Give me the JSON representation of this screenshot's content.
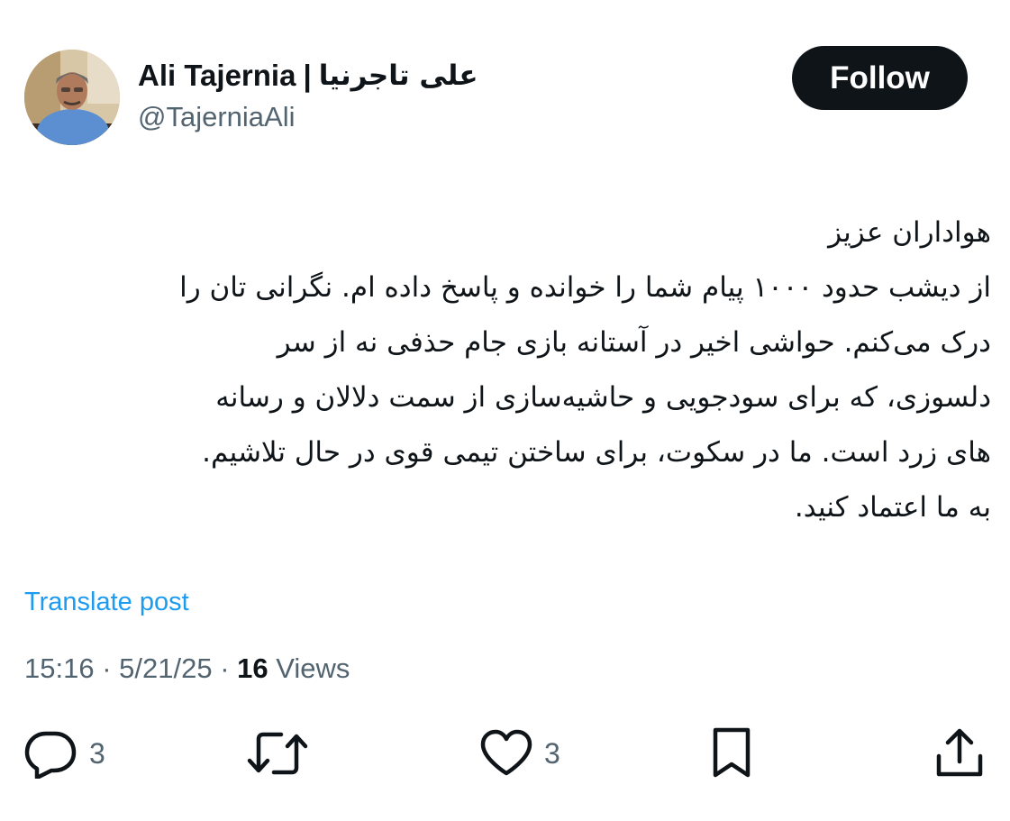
{
  "author": {
    "display_name_en": "Ali Tajernia",
    "separator": "|",
    "display_name_fa": "علی تاجرنیا",
    "handle": "@TajerniaAli"
  },
  "follow_label": "Follow",
  "tweet": {
    "lines": [
      "هواداران عزیز",
      "از دیشب حدود ۱۰۰۰ پیام شما را خوانده و پاسخ داده ام. نگرانی تان  را",
      "درک می‌کنم. حواشی اخیر در آستانه بازی جام حذفی نه از سر",
      "دلسوزی، که برای سودجویی و حاشیه‌سازی از سمت دلالان و رسانه",
      "های زرد است. ما در سکوت، برای ساختن تیمی قوی در حال تلاشیم.",
      "به ما اعتماد کنید."
    ]
  },
  "translate_label": "Translate post",
  "meta": {
    "time": "15:16",
    "dot1": " · ",
    "date": "5/21/25",
    "dot2": " · ",
    "views_count": "16",
    "views_label": " Views"
  },
  "actions": {
    "reply_count": "3",
    "like_count": "3"
  },
  "colors": {
    "text": "#0f1419",
    "secondary": "#536471",
    "link": "#1d9bf0",
    "button_bg": "#0f1419"
  }
}
